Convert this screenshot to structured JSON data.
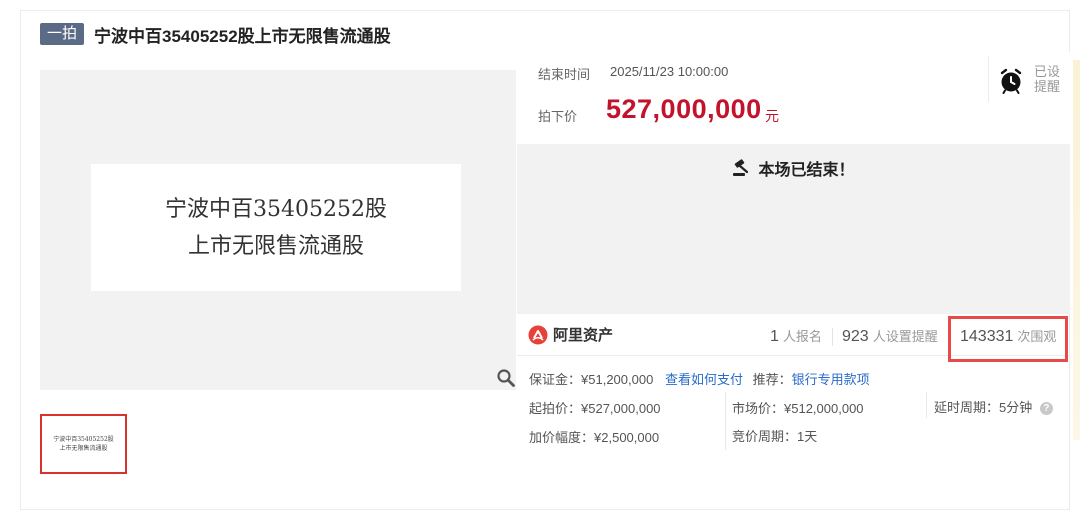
{
  "header": {
    "round_badge": "一拍",
    "title": "宁波中百35405252股上市无限售流通股"
  },
  "gallery": {
    "main_lines": [
      "宁波中百35405252股",
      "上市无限售流通股"
    ],
    "thumb_lines": [
      "宁波中百35405252股",
      "上市无限售流通股"
    ]
  },
  "auction": {
    "end_time_label": "结束时间",
    "end_time_value": "2025/11/23 10:00:00",
    "price_label": "拍下价",
    "price_value": "527,000,000",
    "price_unit": "元",
    "reminder_label": "已设提醒",
    "ended_message": "本场已结束！"
  },
  "stats": {
    "brand_name": "阿里资产",
    "signups_count": "1",
    "signups_label": "人报名",
    "reminders_count": "923",
    "reminders_label": "人设置提醒",
    "views_count": "143331",
    "views_label": "次围观"
  },
  "details": {
    "deposit_label": "保证金：",
    "deposit_value": "¥51,200,000",
    "how_to_pay_link": "查看如何支付",
    "recommend_label": "推荐：",
    "bank_link": "银行专用款项",
    "start_price_label": "起拍价：",
    "start_price_value": "¥527,000,000",
    "market_price_label": "市场价：",
    "market_price_value": "¥512,000,000",
    "delay_label": "延时周期：",
    "delay_value": "5分钟",
    "increment_label": "加价幅度：",
    "increment_value": "¥2,500,000",
    "bid_cycle_label": "竞价周期：",
    "bid_cycle_value": "1天"
  },
  "colors": {
    "price_red": "#c3132c",
    "link_blue": "#2a6cc8",
    "badge_slate": "#5b6b86",
    "highlight_red": "#e84a4a"
  },
  "icons": {
    "zoom": "magnifier-icon",
    "reminder": "alarm-clock-icon",
    "ended": "gavel-icon",
    "brand": "ali-assets-logo-icon",
    "help": "question-circle-icon"
  }
}
